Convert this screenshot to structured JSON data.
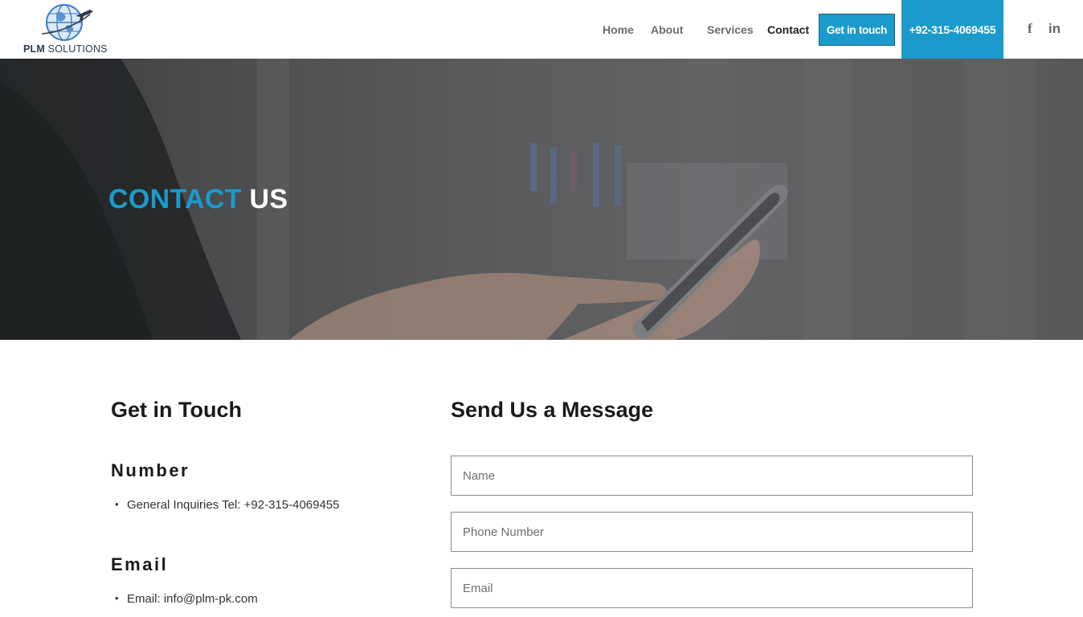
{
  "brand": {
    "logo_bold": "PLM",
    "logo_rest": " SOLUTIONS"
  },
  "nav": {
    "home": "Home",
    "about": "About",
    "services": "Services",
    "contact": "Contact",
    "get_in_touch": "Get in touch",
    "phone": "+92-315-4069455",
    "facebook_icon": "f",
    "linkedin_icon": "in"
  },
  "hero": {
    "title_accent": "CONTACT",
    "title_rest": " US"
  },
  "contact_info": {
    "heading": "Get in Touch",
    "number_heading": "Number",
    "number_item": "General Inquiries Tel: +92-315-4069455",
    "email_heading": "Email",
    "email_item": "Email: info@plm-pk.com"
  },
  "form": {
    "heading": "Send Us a Message",
    "name_placeholder": "Name",
    "phone_placeholder": "Phone Number",
    "email_placeholder": "Email"
  },
  "colors": {
    "accent": "#1b9bcb",
    "hero_overlay": "#4f5052",
    "text_dark": "#1a1a1a"
  },
  "icons": [
    "globe-plane-logo-icon",
    "facebook-icon",
    "linkedin-icon"
  ]
}
